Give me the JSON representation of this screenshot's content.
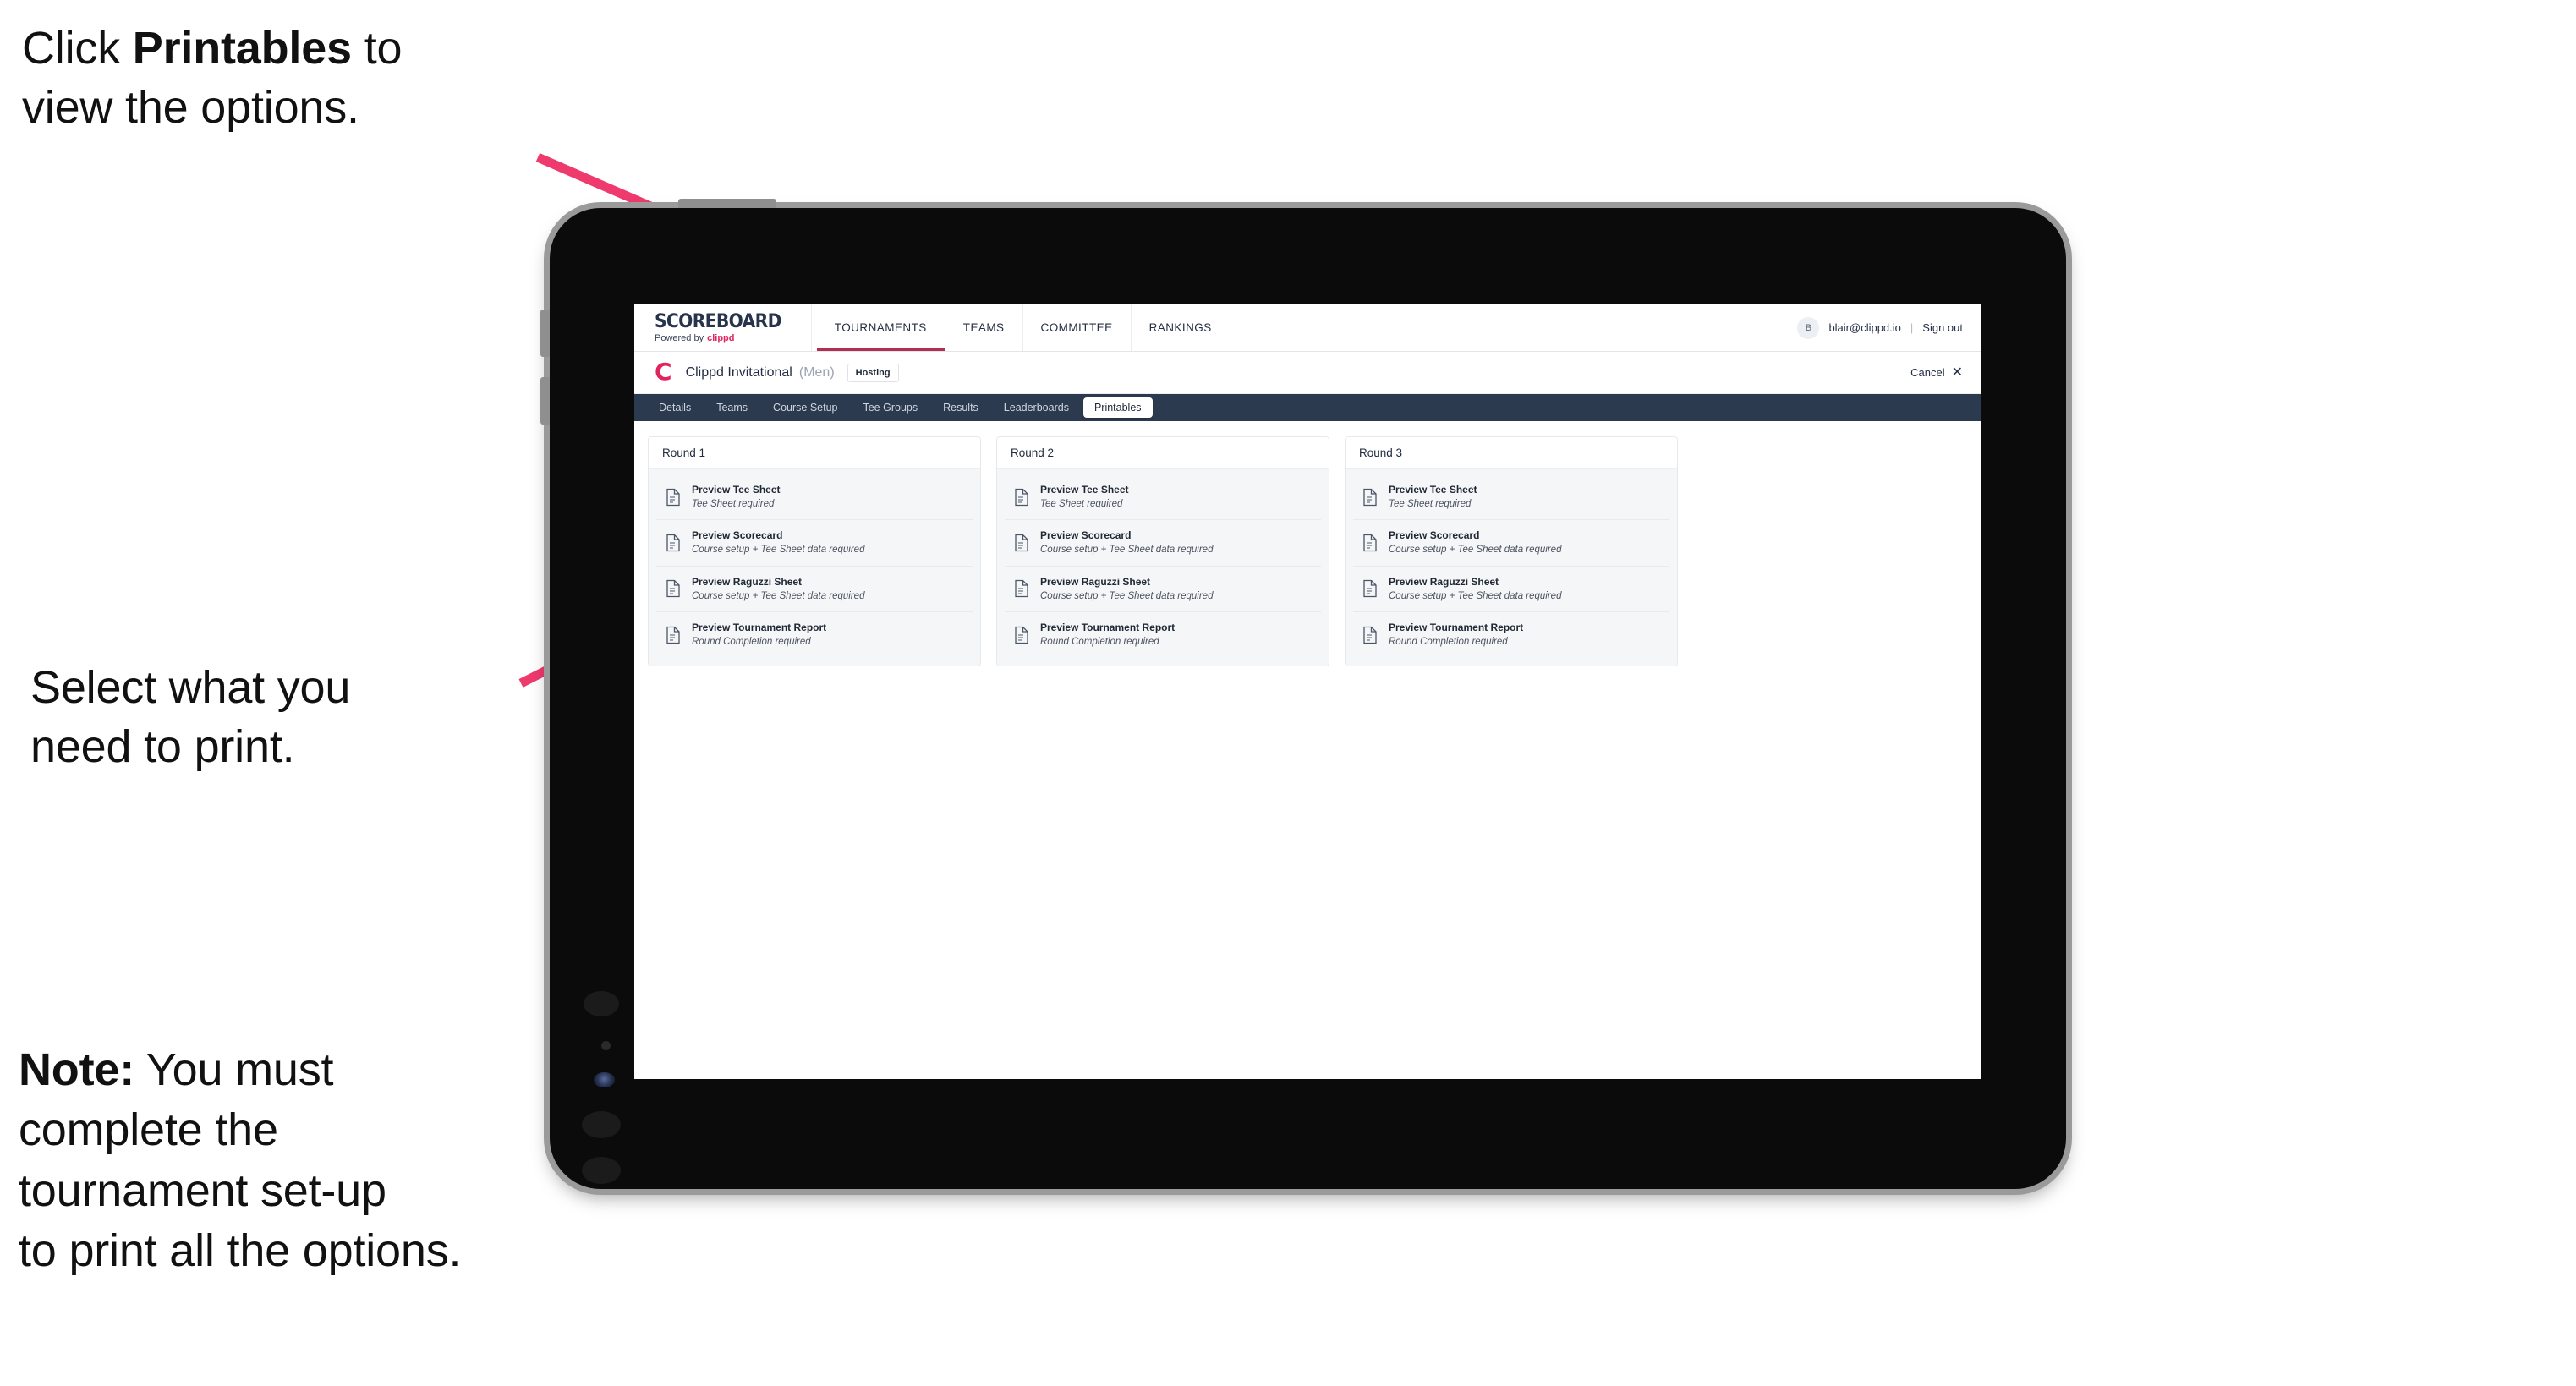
{
  "annotations": {
    "click_printables": {
      "pre": "Click ",
      "bold": "Printables",
      "post": " to\nview the options."
    },
    "select_print": "Select what you\n need to print.",
    "note": {
      "bold": "Note:",
      "rest": " You must\ncomplete the\ntournament set-up\nto print all the options."
    }
  },
  "colors": {
    "accent_pink": "#ee3a6d",
    "brand_pink": "#e0245e",
    "dark_navy": "#2c3a4f",
    "tab_underline": "#b03055"
  },
  "app": {
    "brand": {
      "word": "SCOREBOARD",
      "powered_by": "Powered by",
      "clippd": "clippd"
    },
    "topnav": [
      {
        "label": "TOURNAMENTS",
        "active": true
      },
      {
        "label": "TEAMS",
        "active": false
      },
      {
        "label": "COMMITTEE",
        "active": false
      },
      {
        "label": "RANKINGS",
        "active": false
      }
    ],
    "account": {
      "avatar_initial": "B",
      "email": "blair@clippd.io",
      "separator": "|",
      "sign_out": "Sign out"
    },
    "tournament": {
      "mark": "C",
      "name": "Clippd Invitational",
      "gender": "(Men)",
      "status_badge": "Hosting",
      "cancel_label": "Cancel",
      "cancel_icon": "✕"
    },
    "subtabs": [
      {
        "label": "Details",
        "active": false
      },
      {
        "label": "Teams",
        "active": false
      },
      {
        "label": "Course Setup",
        "active": false
      },
      {
        "label": "Tee Groups",
        "active": false
      },
      {
        "label": "Results",
        "active": false
      },
      {
        "label": "Leaderboards",
        "active": false
      },
      {
        "label": "Printables",
        "active": true
      }
    ],
    "rounds": [
      {
        "title": "Round 1",
        "items": [
          {
            "title": "Preview Tee Sheet",
            "subtitle": "Tee Sheet required"
          },
          {
            "title": "Preview Scorecard",
            "subtitle": "Course setup + Tee Sheet data required"
          },
          {
            "title": "Preview Raguzzi Sheet",
            "subtitle": "Course setup + Tee Sheet data required"
          },
          {
            "title": "Preview Tournament Report",
            "subtitle": "Round Completion required"
          }
        ]
      },
      {
        "title": "Round 2",
        "items": [
          {
            "title": "Preview Tee Sheet",
            "subtitle": "Tee Sheet required"
          },
          {
            "title": "Preview Scorecard",
            "subtitle": "Course setup + Tee Sheet data required"
          },
          {
            "title": "Preview Raguzzi Sheet",
            "subtitle": "Course setup + Tee Sheet data required"
          },
          {
            "title": "Preview Tournament Report",
            "subtitle": "Round Completion required"
          }
        ]
      },
      {
        "title": "Round 3",
        "items": [
          {
            "title": "Preview Tee Sheet",
            "subtitle": "Tee Sheet required"
          },
          {
            "title": "Preview Scorecard",
            "subtitle": "Course setup + Tee Sheet data required"
          },
          {
            "title": "Preview Raguzzi Sheet",
            "subtitle": "Course setup + Tee Sheet data required"
          },
          {
            "title": "Preview Tournament Report",
            "subtitle": "Round Completion required"
          }
        ]
      }
    ]
  }
}
